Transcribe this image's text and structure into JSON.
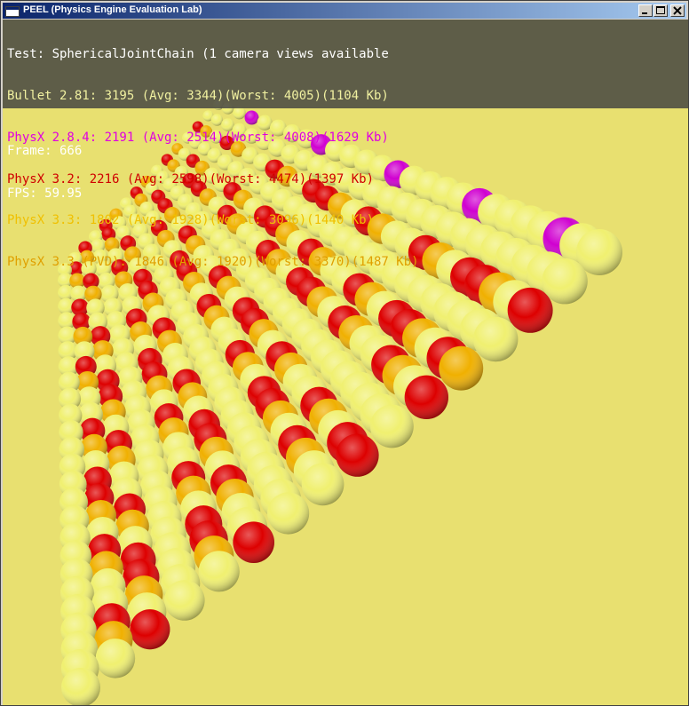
{
  "window": {
    "title": "PEEL (Physics Engine Evaluation Lab)",
    "controls": [
      "minimize",
      "maximize",
      "close"
    ]
  },
  "overlay": {
    "test_line": "Test: SphericalJointChain (1 camera views available",
    "engines": [
      {
        "text": "Bullet 2.81: 3195 (Avg: 3344)(Worst: 4005)(1104 Kb)",
        "color": "#f0f0a0"
      },
      {
        "text": "PhysX 2.8.4: 2191 (Avg: 2514)(Worst: 4008)(1629 Kb)",
        "color": "#e000e0"
      },
      {
        "text": "PhysX 3.2: 2216 (Avg: 2598)(Worst: 4474)(1397 Kb)",
        "color": "#d00000"
      },
      {
        "text": "PhysX 3.3: 1802 (Avg: 1928)(Worst: 3096)(1440 Kb)",
        "color": "#f0c000"
      },
      {
        "text": "PhysX 3.3 (PVD): 1846 (Avg: 1920)(Worst: 3370)(1487 Kb)",
        "color": "#e0a000"
      }
    ]
  },
  "stats": {
    "frame": "Frame: 666",
    "fps": "FPS: 59.95"
  },
  "scene": {
    "ground_color": "#e8e070",
    "sphere_colors": {
      "red": "#dd0000",
      "yellow": "#f0f070",
      "orange": "#f0b000",
      "magenta": "#d000d0"
    }
  }
}
